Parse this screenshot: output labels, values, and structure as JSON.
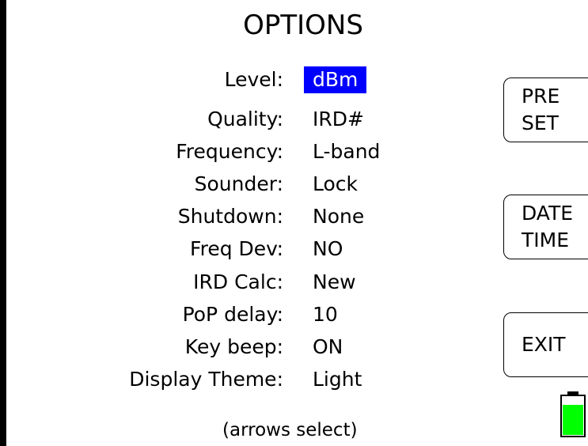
{
  "title": "OPTIONS",
  "options": [
    {
      "label": "Level:",
      "value": "dBm",
      "selected": true
    },
    {
      "label": "Quality:",
      "value": "IRD#"
    },
    {
      "label": "Frequency:",
      "value": "L-band"
    },
    {
      "label": "Sounder:",
      "value": "Lock"
    },
    {
      "label": "Shutdown:",
      "value": "None"
    },
    {
      "label": "Freq Dev:",
      "value": "NO"
    },
    {
      "label": "IRD Calc:",
      "value": "New"
    },
    {
      "label": "PoP delay:",
      "value": "10"
    },
    {
      "label": "Key beep:",
      "value": "ON"
    },
    {
      "label": "Display Theme:",
      "value": "Light"
    }
  ],
  "buttons": {
    "preset": {
      "line1": "PRE",
      "line2": "SET"
    },
    "date_time": {
      "line1": "DATE",
      "line2": "TIME"
    },
    "exit": {
      "label": "EXIT"
    }
  },
  "hint": "(arrows select)",
  "battery": {
    "icon": "battery-icon",
    "level": 0.75,
    "color": "#00ff00"
  },
  "colors": {
    "selection_bg": "#0000ff",
    "selection_fg": "#ffffff",
    "background": "#ffffff",
    "frame": "#000000"
  }
}
